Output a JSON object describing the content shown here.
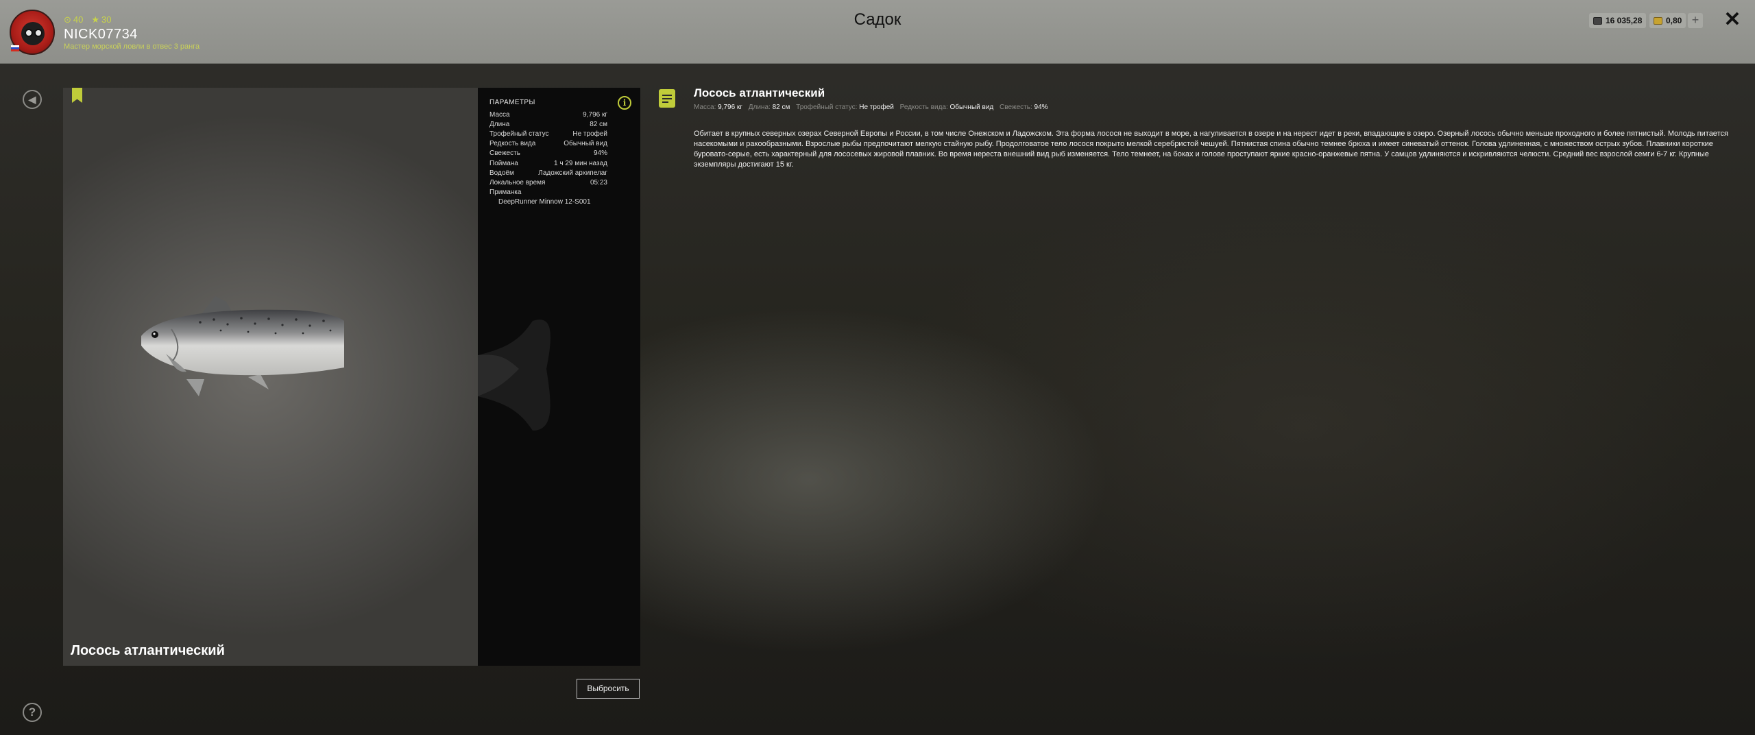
{
  "header": {
    "title": "Садок",
    "player": {
      "level": "40",
      "stars": "30",
      "nickname": "NICK07734",
      "rank": "Мастер морской ловли в отвес 3 ранга"
    },
    "currency": {
      "silver": "16 035,28",
      "gold": "0,80",
      "add_label": "+"
    },
    "close_label": "✕"
  },
  "side": {
    "back_label": "◀",
    "help_label": "?"
  },
  "fish": {
    "name": "Лосось атлантический",
    "params_header": "ПАРАМЕТРЫ",
    "info_label": "i",
    "params": [
      {
        "label": "Масса",
        "value": "9,796 кг"
      },
      {
        "label": "Длина",
        "value": "82 см"
      },
      {
        "label": "Трофейный статус",
        "value": "Не трофей"
      },
      {
        "label": "Редкость вида",
        "value": "Обычный вид"
      },
      {
        "label": "Свежесть",
        "value": "94%"
      },
      {
        "label": "Поймана",
        "value": "1 ч 29 мин назад"
      },
      {
        "label": "Водоём",
        "value": "Ладожский архипелаг"
      },
      {
        "label": "Локальное время",
        "value": "05:23"
      }
    ],
    "lure_label": "Приманка",
    "lure_value": "DeepRunner Minnow 12-S001",
    "release_label": "Выбросить"
  },
  "description": {
    "title": "Лосось атлантический",
    "stats": [
      {
        "k": "Масса:",
        "v": "9,796 кг"
      },
      {
        "k": "Длина:",
        "v": "82 см"
      },
      {
        "k": "Трофейный статус:",
        "v": "Не трофей"
      },
      {
        "k": "Редкость вида:",
        "v": "Обычный вид"
      },
      {
        "k": "Свежесть:",
        "v": "94%"
      }
    ],
    "body": "Обитает в крупных северных озерах Северной Европы и России, в том числе Онежском и Ладожском. Эта форма лосося не выходит в море, а нагуливается в озере и на нерест идет в реки, впадающие в озеро. Озерный лосось обычно меньше проходного и более пятнистый. Молодь питается насекомыми и ракообразными. Взрослые рыбы предпочитают мелкую стайную рыбу. Продолговатое тело лосося покрыто мелкой серебристой чешуей. Пятнистая спина обычно темнее брюха и имеет синеватый оттенок. Голова удлиненная, с множеством острых зубов. Плавники короткие буровато-серые, есть характерный для лососевых жировой плавник. Во время нереста внешний вид рыб изменяется. Тело темнеет, на боках и голове проступают яркие красно-оранжевые пятна. У самцов удлиняются и искривляются челюсти. Средний вес взрослой семги 6-7 кг. Крупные экземпляры достигают 15 кг."
  },
  "colors": {
    "accent": "#c0cc3a",
    "header_bg": "#9a9b96"
  }
}
